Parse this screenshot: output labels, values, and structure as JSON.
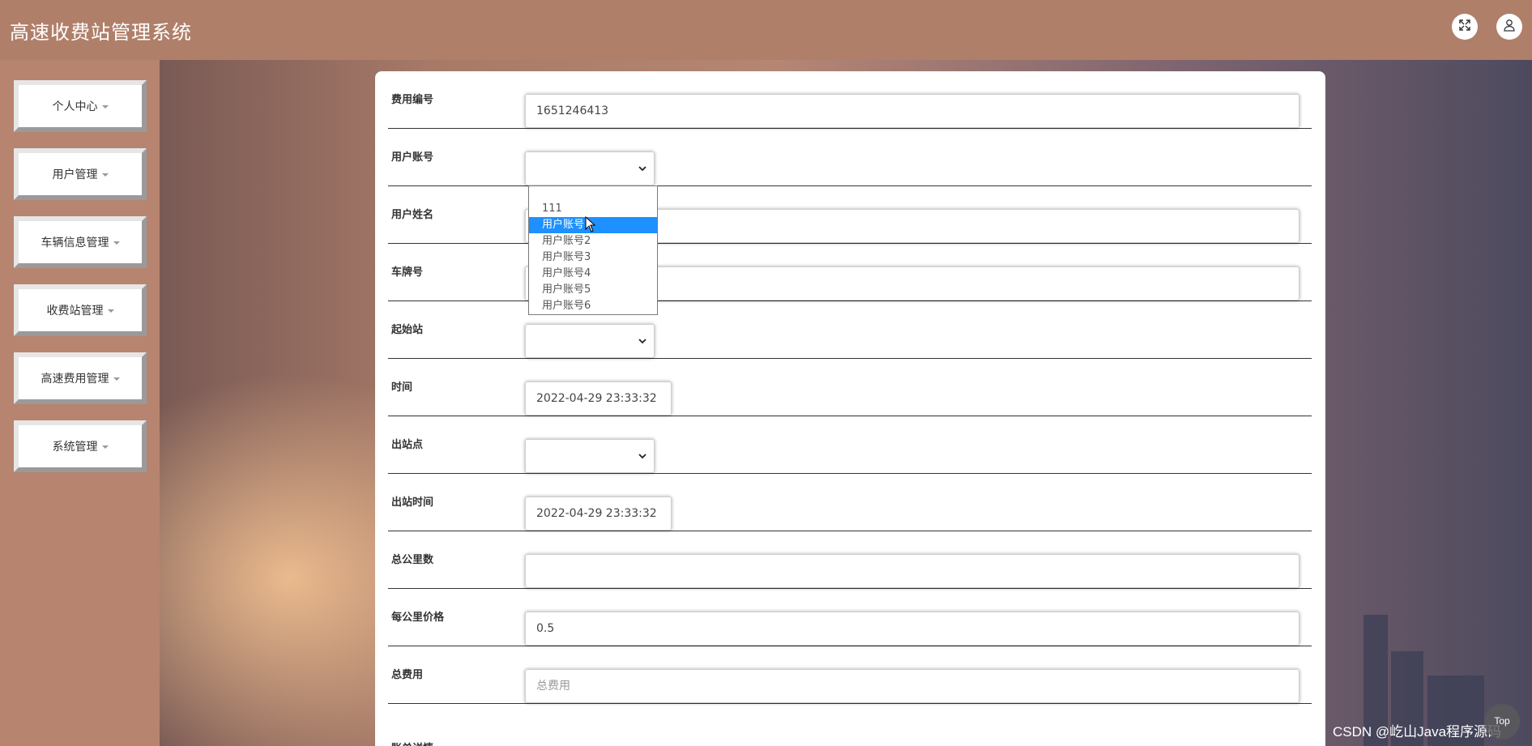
{
  "header": {
    "title": "高速收费站管理系统",
    "fullscreen_icon": "expand-icon",
    "user_icon": "user-icon"
  },
  "sidebar": {
    "items": [
      {
        "label": "个人中心"
      },
      {
        "label": "用户管理"
      },
      {
        "label": "车辆信息管理"
      },
      {
        "label": "收费站管理"
      },
      {
        "label": "高速费用管理"
      },
      {
        "label": "系统管理"
      }
    ]
  },
  "form": {
    "fee_no": {
      "label": "费用编号",
      "value": "1651246413"
    },
    "user_account": {
      "label": "用户账号",
      "value": ""
    },
    "user_name": {
      "label": "用户姓名",
      "value": ""
    },
    "plate_no": {
      "label": "车牌号",
      "value": ""
    },
    "start_station": {
      "label": "起始站",
      "value": ""
    },
    "time": {
      "label": "时间",
      "value": "2022-04-29 23:33:32"
    },
    "exit_station": {
      "label": "出站点",
      "value": ""
    },
    "exit_time": {
      "label": "出站时间",
      "value": "2022-04-29 23:33:32"
    },
    "total_km": {
      "label": "总公里数",
      "value": ""
    },
    "price_per_km": {
      "label": "每公里价格",
      "value": "0.5"
    },
    "total_fee": {
      "label": "总费用",
      "placeholder": "总费用"
    },
    "bill_details": {
      "label": "账单详情"
    }
  },
  "account_dropdown": {
    "options": [
      "111",
      "用户账号1",
      "用户账号2",
      "用户账号3",
      "用户账号4",
      "用户账号5",
      "用户账号6"
    ],
    "highlighted": "用户账号1"
  },
  "footer": {
    "watermark": "CSDN @屹山Java程序源码",
    "top_label": "Top"
  },
  "colors": {
    "header_bg": "#b07f6a",
    "highlight": "#1e90ff"
  }
}
